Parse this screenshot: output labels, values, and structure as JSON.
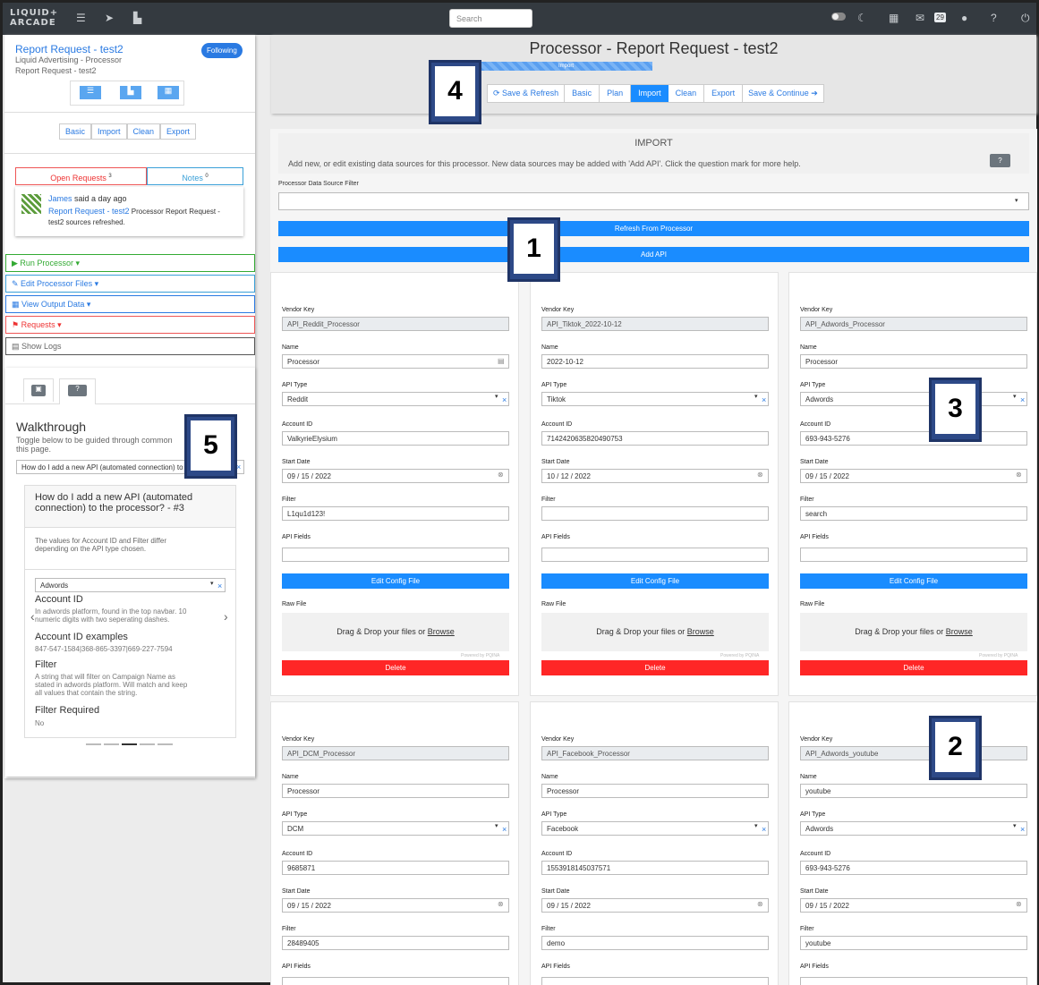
{
  "nav": {
    "logo_line1": "LIQUID+",
    "logo_line2": "ARCADE",
    "search_placeholder": "Search",
    "badge": "29"
  },
  "left": {
    "title": "Report Request - test2",
    "following": "Following",
    "sub1": "Liquid Advertising - Processor",
    "sub2": "Report Request - test2",
    "tabs": [
      "Basic",
      "Import",
      "Clean",
      "Export"
    ],
    "open_requests": "Open Requests",
    "open_count": "3",
    "notes": "Notes",
    "notes_count": "0",
    "note_user": "James",
    "note_said": " said a day ago",
    "note_link": "Report Request - test2",
    "note_text1": " Processor Report Request -",
    "note_text2": "test2 sources refreshed.",
    "actions": {
      "run": "Run Processor",
      "edit": "Edit Processor Files",
      "view": "View Output Data",
      "req": "Requests",
      "logs": "Show Logs"
    },
    "walk_title": "Walkthrough",
    "walk_desc1": "Toggle below to be guided through common",
    "walk_desc2": "this page.",
    "walk_select": "How do I add a new API (automated connection) to the processor?",
    "slide_title1": "How do I add a new API (automated",
    "slide_title2": "connection) to the processor? - #3",
    "slide_body1": "The values for Account ID and Filter differ",
    "slide_body2": "depending on the API type chosen.",
    "slide_select": "Adwords",
    "acct_h": "Account ID",
    "acct_t1": "In adwords platform, found in the top navbar. 10",
    "acct_t2": "numeric digits with two seperating dashes.",
    "ex_h": "Account ID examples",
    "ex_t": "847-547-1584|368-865-3397|669-227-7594",
    "filter_h": "Filter",
    "filter_t1": "A string that will filter on Campaign Name as",
    "filter_t2": "stated in adwords platform. Will match and keep",
    "filter_t3": "all values that contain the string.",
    "freq_h": "Filter Required",
    "freq_t": "No"
  },
  "header": {
    "title": "Processor - Report Request - test2",
    "progress_label": "Import",
    "progress": 1.0,
    "steps": [
      "Save & Refresh",
      "Basic",
      "Plan",
      "Import",
      "Clean",
      "Export",
      "Save & Continue"
    ]
  },
  "import": {
    "title": "IMPORT",
    "desc": "Add new, or edit existing data sources for this processor. New data sources may be added with 'Add API'. Click the question mark for more help.",
    "filter_label": "Processor Data Source Filter",
    "refresh": "Refresh From Processor",
    "add_api": "Add API"
  },
  "labels": {
    "vendor": "Vendor Key",
    "name": "Name",
    "type": "API Type",
    "account": "Account ID",
    "start": "Start Date",
    "filter": "Filter",
    "fields": "API Fields",
    "raw": "Raw File",
    "edit": "Edit Config File",
    "delete": "Delete",
    "drop": "Drag & Drop your files or ",
    "browse": "Browse",
    "powered": "Powered by PQINA"
  },
  "cards": [
    {
      "vendor": "API_Reddit_Processor",
      "name": "Processor",
      "type": "Reddit",
      "account": "ValkyrieElysium",
      "start": "09 / 15 / 2022",
      "filter": "L1qu1d123!",
      "fields": ""
    },
    {
      "vendor": "API_Tiktok_2022-10-12",
      "name": "2022-10-12",
      "type": "Tiktok",
      "account": "7142420635820490753",
      "start": "10 / 12 / 2022",
      "filter": "",
      "fields": ""
    },
    {
      "vendor": "API_Adwords_Processor",
      "name": "Processor",
      "type": "Adwords",
      "account": "693-943-5276",
      "start": "09 / 15 / 2022",
      "filter": "search",
      "fields": ""
    },
    {
      "vendor": "API_DCM_Processor",
      "name": "Processor",
      "type": "DCM",
      "account": "9685871",
      "start": "09 / 15 / 2022",
      "filter": "28489405"
    },
    {
      "vendor": "API_Facebook_Processor",
      "name": "Processor",
      "type": "Facebook",
      "account": "1553918145037571",
      "start": "09 / 15 / 2022",
      "filter": "demo"
    },
    {
      "vendor": "API_Adwords_youtube",
      "name": "youtube",
      "type": "Adwords",
      "account": "693-943-5276",
      "start": "09 / 15 / 2022",
      "filter": "youtube"
    }
  ],
  "markers": [
    "1",
    "2",
    "3",
    "4",
    "5"
  ]
}
